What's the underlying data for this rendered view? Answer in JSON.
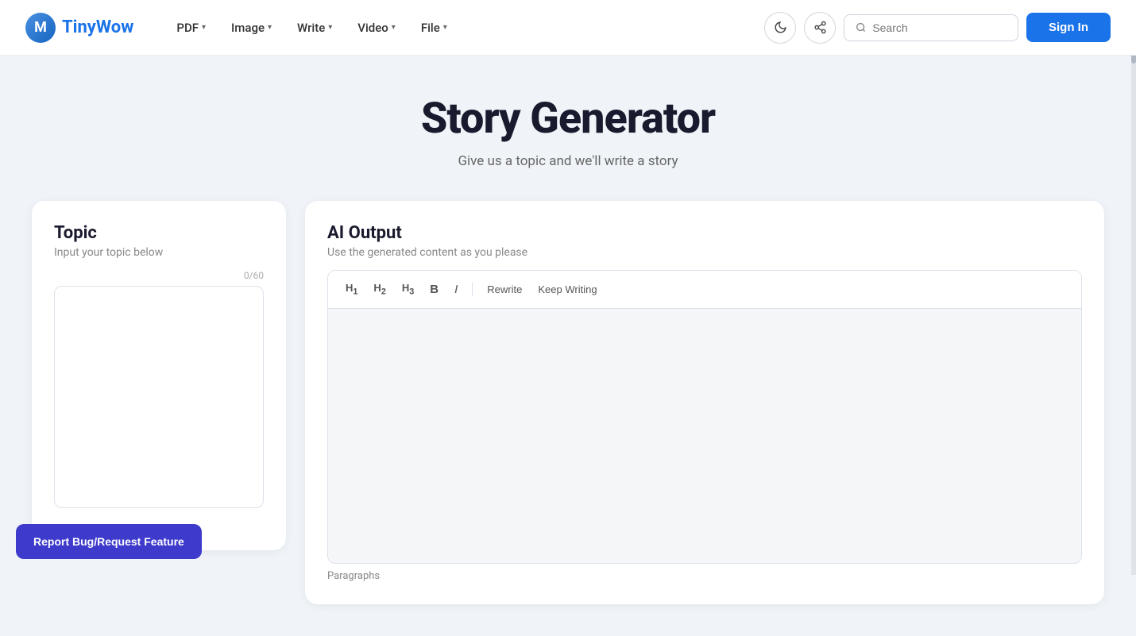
{
  "logo": {
    "icon_letter": "M",
    "tiny": "Tiny",
    "wow": "Wow"
  },
  "nav": {
    "items": [
      {
        "label": "PDF",
        "has_dropdown": true
      },
      {
        "label": "Image",
        "has_dropdown": true
      },
      {
        "label": "Write",
        "has_dropdown": true
      },
      {
        "label": "Video",
        "has_dropdown": true
      },
      {
        "label": "File",
        "has_dropdown": true
      }
    ]
  },
  "search": {
    "placeholder": "Search"
  },
  "header_btn": {
    "signin": "Sign In"
  },
  "page": {
    "title": "Story Generator",
    "subtitle": "Give us a topic and we'll write a story"
  },
  "topic_card": {
    "title": "Topic",
    "subtitle": "Input your topic below",
    "char_count": "0/60",
    "textarea_placeholder": ""
  },
  "ai_card": {
    "title": "AI Output",
    "subtitle": "Use the generated content as you please"
  },
  "toolbar": {
    "h1": "H₁",
    "h2": "H₂",
    "h3": "H₃",
    "bold": "B",
    "italic": "I",
    "rewrite": "Rewrite",
    "keep_writing": "Keep Writing"
  },
  "bottom": {
    "paragraphs_label": "Paragraphs"
  },
  "report_bug": {
    "label": "Report Bug/Request Feature"
  }
}
